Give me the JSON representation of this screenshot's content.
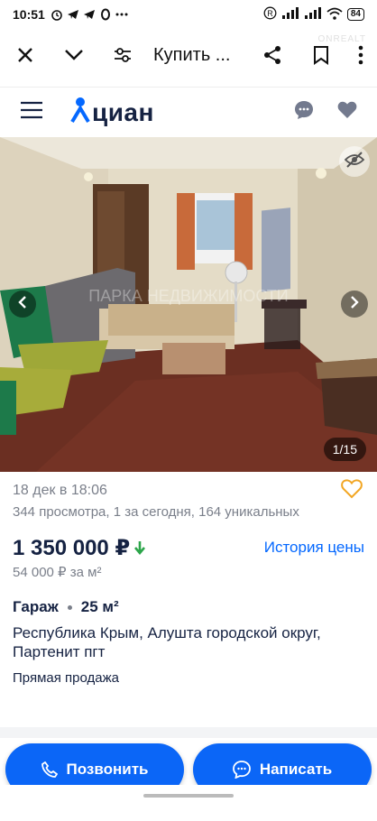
{
  "status": {
    "time": "10:51",
    "battery": "84"
  },
  "browser": {
    "title": "Купить ...",
    "watermark": "ONREALT"
  },
  "app": {
    "logo_text": "циан"
  },
  "gallery": {
    "counter": "1/15",
    "watermark": "ПАРКА НЕДВИЖИМОСТИ"
  },
  "listing": {
    "date": "18 дек в 18:06",
    "views": "344 просмотра, 1 за сегодня, 164 уникальных",
    "price": "1 350 000 ₽",
    "price_history": "История цены",
    "price_per_m": "54 000 ₽ за м²",
    "type": "Гараж",
    "area": "25 м²",
    "address": "Республика Крым, Алушта городской округ, Партенит пгт",
    "sale_type": "Прямая продажа"
  },
  "actions": {
    "call": "Позвонить",
    "message": "Написать"
  },
  "colors": {
    "brand": "#0468ff",
    "button": "#0b66f7",
    "text": "#152242",
    "muted": "#7a7f8a",
    "favorite": "#f2a623",
    "price_down": "#2ca54a"
  }
}
